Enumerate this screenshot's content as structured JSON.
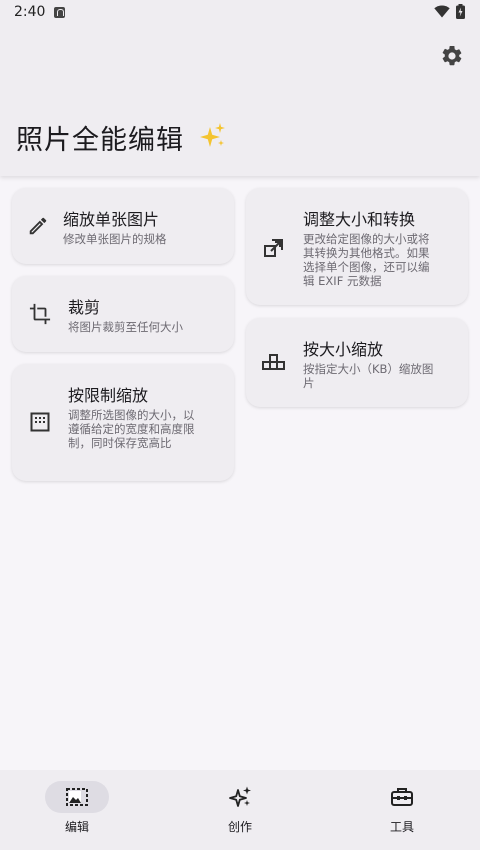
{
  "status_bar": {
    "time": "2:40"
  },
  "header": {
    "title": "照片全能编辑",
    "sparkle_icon": "sparkles-icon",
    "settings_icon": "gear-icon"
  },
  "cards": {
    "resize_single": {
      "title": "缩放单张图片",
      "desc": "修改单张图片的规格",
      "icon": "pencil-icon"
    },
    "crop": {
      "title": "裁剪",
      "desc": "将图片裁剪至任何大小",
      "icon": "crop-icon"
    },
    "limit_resize": {
      "title": "按限制缩放",
      "desc": "调整所选图像的大小，以遵循给定的宽度和高度限制，同时保存宽高比",
      "icon": "aspect-grid-icon"
    },
    "resize_convert": {
      "title": "调整大小和转换",
      "desc": "更改给定图像的大小或将其转换为其他格式。如果选择单个图像，还可以编辑 EXIF 元数据",
      "icon": "resize-convert-icon"
    },
    "resize_by_size": {
      "title": "按大小缩放",
      "desc": "按指定大小（KB）缩放图片",
      "icon": "size-blocks-icon"
    }
  },
  "bottom_nav": {
    "items": [
      {
        "label": "编辑",
        "icon": "image-edit-icon",
        "active": true
      },
      {
        "label": "创作",
        "icon": "sparkles-icon",
        "active": false
      },
      {
        "label": "工具",
        "icon": "toolbox-icon",
        "active": false
      }
    ]
  },
  "colors": {
    "background": "#f7f5f9",
    "surface": "#efedf1",
    "active_pill": "#dedce3",
    "text": "#1c1b1f",
    "muted": "#6d6a72",
    "sparkle": "#f4c430"
  }
}
